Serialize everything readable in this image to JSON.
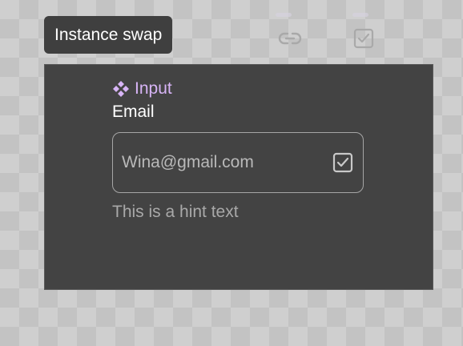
{
  "tag": {
    "label": "Instance swap"
  },
  "toolbar": {
    "icons": [
      "link-icon",
      "checkbox-icon"
    ]
  },
  "component": {
    "name": "Input",
    "icon": "component-diamond-icon",
    "field_label": "Email",
    "input_value": "Wina@gmail.com",
    "input_icon": "checkbox-checked-icon",
    "hint": "This is a hint text"
  },
  "colors": {
    "panel_bg": "#434343",
    "tag_bg": "#3f3f3f",
    "component_accent": "#d7b4f6",
    "border": "#a6a6a6"
  }
}
